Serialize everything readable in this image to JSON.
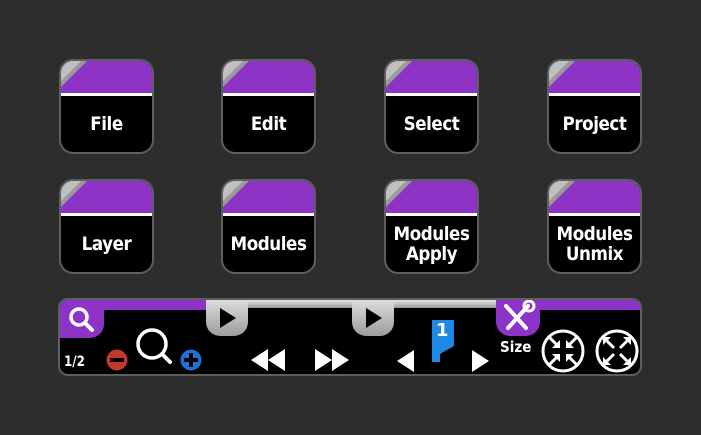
{
  "tiles": [
    {
      "label": "File"
    },
    {
      "label": "Edit"
    },
    {
      "label": "Select"
    },
    {
      "label": "Project"
    },
    {
      "label": "Layer"
    },
    {
      "label": "Modules"
    },
    {
      "label": "Modules\nApply"
    },
    {
      "label": "Modules\nUnmix"
    }
  ],
  "toolbar": {
    "page_indicator": "1/2",
    "size_label": "Size",
    "marker_number": "1",
    "accent_color": "#8d34c7",
    "zoom_out_color": "#c0392b",
    "zoom_in_color": "#1e6fd9",
    "marker_color": "#1e88e5"
  }
}
